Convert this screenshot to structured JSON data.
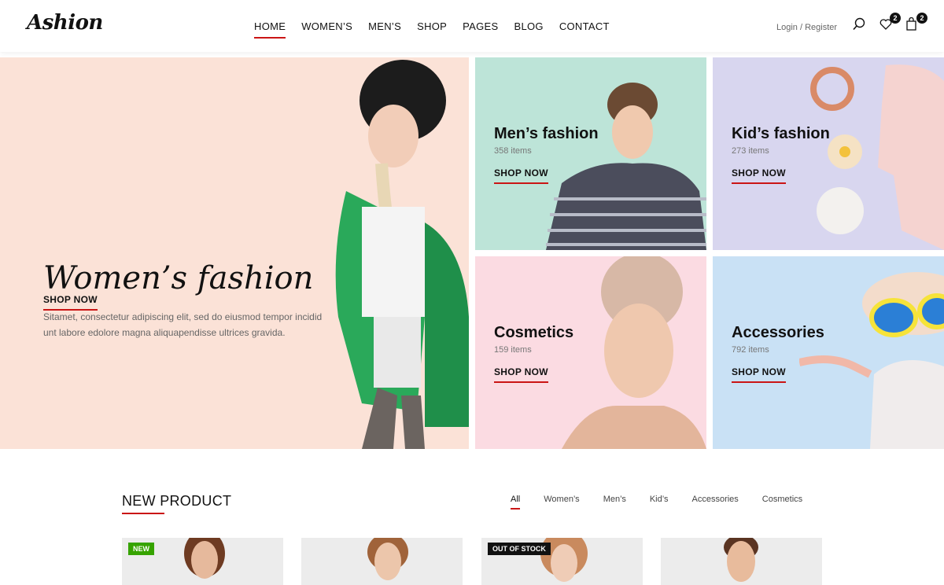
{
  "header": {
    "logo": "Ashion",
    "nav": [
      {
        "label": "HOME",
        "active": true
      },
      {
        "label": "WOMEN’S",
        "active": false
      },
      {
        "label": "MEN’S",
        "active": false
      },
      {
        "label": "SHOP",
        "active": false
      },
      {
        "label": "PAGES",
        "active": false
      },
      {
        "label": "BLOG",
        "active": false
      },
      {
        "label": "CONTACT",
        "active": false
      }
    ],
    "login_register": "Login / Register",
    "icons": {
      "search": "search-icon",
      "wishlist": "heart-icon",
      "cart": "shopping-bag-icon"
    },
    "wishlist_count": "2",
    "cart_count": "2"
  },
  "hero": {
    "main": {
      "title": "Women’s fashion",
      "description": "Sitamet, consectetur adipiscing elit, sed do eiusmod tempor incidid unt labore edolore magna aliquapendisse ultrices gravida.",
      "cta": "SHOP NOW",
      "bg_color": "#fbe2d7"
    },
    "tiles": [
      {
        "title": "Men’s fashion",
        "count": "358 items",
        "cta": "SHOP NOW",
        "bg_color": "#bde4d8"
      },
      {
        "title": "Kid’s fashion",
        "count": "273 items",
        "cta": "SHOP NOW",
        "bg_color": "#d8d6ef"
      },
      {
        "title": "Cosmetics",
        "count": "159 items",
        "cta": "SHOP NOW",
        "bg_color": "#fbdbe2"
      },
      {
        "title": "Accessories",
        "count": "792 items",
        "cta": "SHOP NOW",
        "bg_color": "#c9e1f5"
      }
    ]
  },
  "new_product": {
    "title": "NEW PRODUCT",
    "filters": [
      {
        "label": "All",
        "active": true
      },
      {
        "label": "Women’s",
        "active": false
      },
      {
        "label": "Men’s",
        "active": false
      },
      {
        "label": "Kid’s",
        "active": false
      },
      {
        "label": "Accessories",
        "active": false
      },
      {
        "label": "Cosmetics",
        "active": false
      }
    ],
    "products": [
      {
        "label": "NEW"
      },
      {
        "label": ""
      },
      {
        "label": "OUT OF STOCK"
      },
      {
        "label": ""
      }
    ]
  },
  "colors": {
    "accent": "#ca1515",
    "new_badge": "#36a300",
    "oos_badge": "#111111"
  }
}
